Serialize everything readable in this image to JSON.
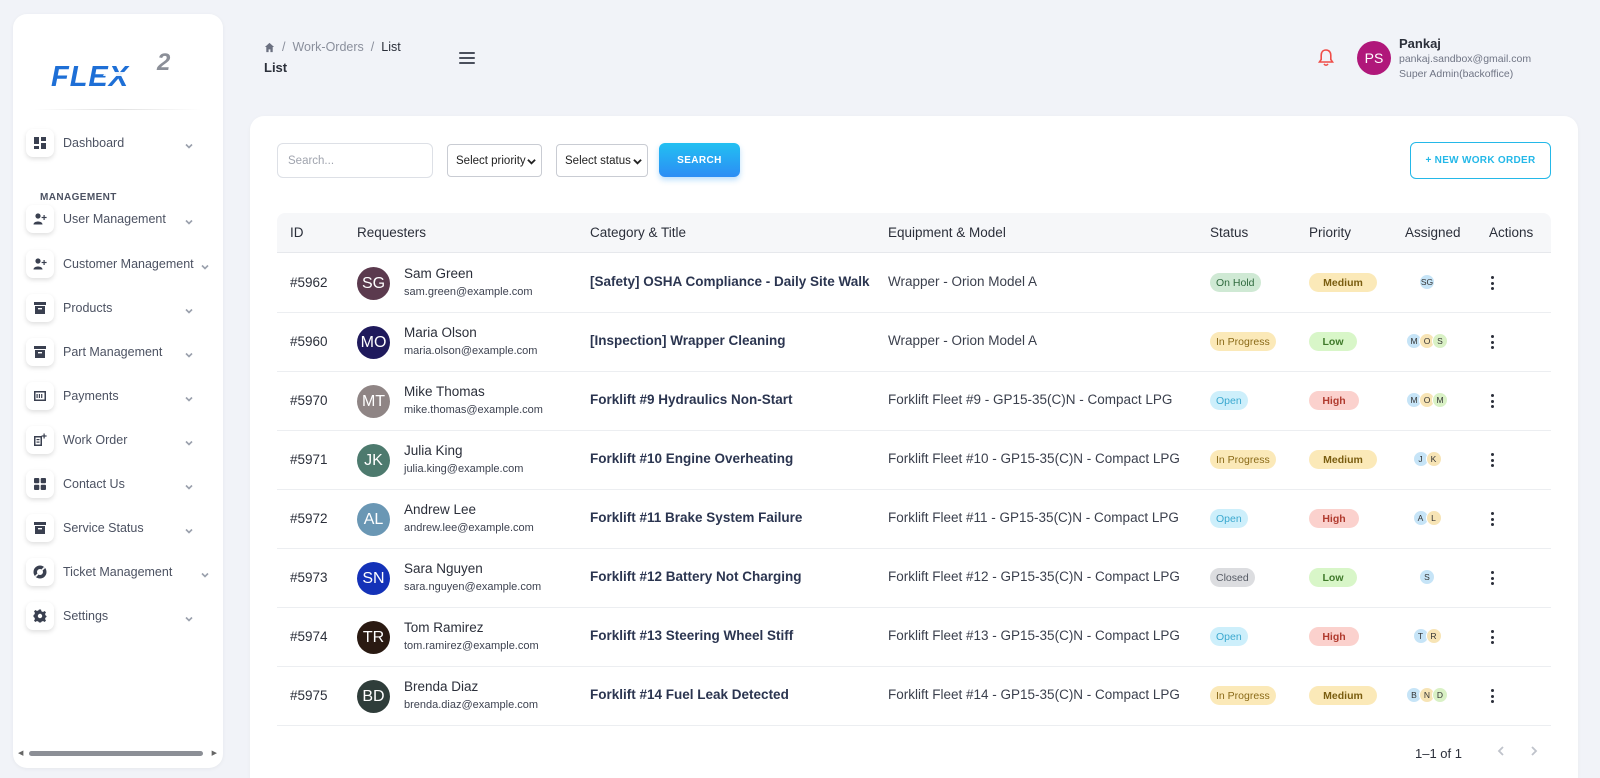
{
  "sidebar": {
    "logo_text": "FLEX",
    "logo_super": "2",
    "section_management": "MANAGEMENT",
    "items": [
      {
        "label": "Dashboard",
        "icon": "dashboard-icon"
      },
      {
        "label": "User Management",
        "icon": "user-add-icon"
      },
      {
        "label": "Customer Management",
        "icon": "user-add-icon"
      },
      {
        "label": "Products",
        "icon": "archive-icon"
      },
      {
        "label": "Part Management",
        "icon": "archive-icon"
      },
      {
        "label": "Payments",
        "icon": "payment-icon"
      },
      {
        "label": "Work Order",
        "icon": "work-order-icon"
      },
      {
        "label": "Contact Us",
        "icon": "grid-icon"
      },
      {
        "label": "Service Status",
        "icon": "archive-icon"
      },
      {
        "label": "Ticket Management",
        "icon": "support-icon"
      },
      {
        "label": "Settings",
        "icon": "gear-icon"
      }
    ]
  },
  "header": {
    "breadcrumb": [
      "Work-Orders",
      "List"
    ],
    "title": "List"
  },
  "user": {
    "initials": "PS",
    "name": "Pankaj",
    "email": "pankaj.sandbox@gmail.com",
    "role": "Super Admin(backoffice)",
    "avatar_color": "#b0177a"
  },
  "toolbar": {
    "search_placeholder": "Search...",
    "priority_select": "Select priority",
    "status_select": "Select status",
    "search_button": "SEARCH",
    "new_button": "+ NEW WORK ORDER"
  },
  "table": {
    "columns": [
      "ID",
      "Requesters",
      "Category & Title",
      "Equipment & Model",
      "Status",
      "Priority",
      "Assigned",
      "Actions"
    ],
    "rows": [
      {
        "id": "#5962",
        "initials": "SG",
        "avatar_color": "#5b3a4e",
        "name": "Sam Green",
        "email": "sam.green@example.com",
        "title": "[Safety] OSHA Compliance - Daily Site Walk",
        "equipment": "Wrapper - Orion Model A",
        "status": "On Hold",
        "priority": "Medium",
        "assigned": [
          "SG"
        ]
      },
      {
        "id": "#5960",
        "initials": "MO",
        "avatar_color": "#1f1a5c",
        "name": "Maria Olson",
        "email": "maria.olson@example.com",
        "title": "[Inspection] Wrapper Cleaning",
        "equipment": "Wrapper - Orion Model A",
        "status": "In Progress",
        "priority": "Low",
        "assigned": [
          "M",
          "O",
          "S"
        ]
      },
      {
        "id": "#5970",
        "initials": "MT",
        "avatar_color": "#8f8585",
        "name": "Mike Thomas",
        "email": "mike.thomas@example.com",
        "title": "Forklift #9 Hydraulics Non-Start",
        "equipment": "Forklift Fleet #9 - GP15-35(C)N - Compact LPG",
        "status": "Open",
        "priority": "High",
        "assigned": [
          "M",
          "O",
          "M"
        ]
      },
      {
        "id": "#5971",
        "initials": "JK",
        "avatar_color": "#4d7a6e",
        "name": "Julia King",
        "email": "julia.king@example.com",
        "title": "Forklift #10 Engine Overheating",
        "equipment": "Forklift Fleet #10 - GP15-35(C)N - Compact LPG",
        "status": "In Progress",
        "priority": "Medium",
        "assigned": [
          "J",
          "K"
        ]
      },
      {
        "id": "#5972",
        "initials": "AL",
        "avatar_color": "#6a97b4",
        "name": "Andrew Lee",
        "email": "andrew.lee@example.com",
        "title": "Forklift #11 Brake System Failure",
        "equipment": "Forklift Fleet #11 - GP15-35(C)N - Compact LPG",
        "status": "Open",
        "priority": "High",
        "assigned": [
          "A",
          "L"
        ]
      },
      {
        "id": "#5973",
        "initials": "SN",
        "avatar_color": "#1432b8",
        "name": "Sara Nguyen",
        "email": "sara.nguyen@example.com",
        "title": "Forklift #12 Battery Not Charging",
        "equipment": "Forklift Fleet #12 - GP15-35(C)N - Compact LPG",
        "status": "Closed",
        "priority": "Low",
        "assigned": [
          "S"
        ]
      },
      {
        "id": "#5974",
        "initials": "TR",
        "avatar_color": "#2a1a12",
        "name": "Tom Ramirez",
        "email": "tom.ramirez@example.com",
        "title": "Forklift #13 Steering Wheel Stiff",
        "equipment": "Forklift Fleet #13 - GP15-35(C)N - Compact LPG",
        "status": "Open",
        "priority": "High",
        "assigned": [
          "T",
          "R"
        ]
      },
      {
        "id": "#5975",
        "initials": "BD",
        "avatar_color": "#2f3d3a",
        "name": "Brenda Diaz",
        "email": "brenda.diaz@example.com",
        "title": "Forklift #14 Fuel Leak Detected",
        "equipment": "Forklift Fleet #14 - GP15-35(C)N - Compact LPG",
        "status": "In Progress",
        "priority": "Medium",
        "assigned": [
          "B",
          "N",
          "D"
        ]
      }
    ]
  },
  "pagination": {
    "text": "1–1 of 1"
  }
}
